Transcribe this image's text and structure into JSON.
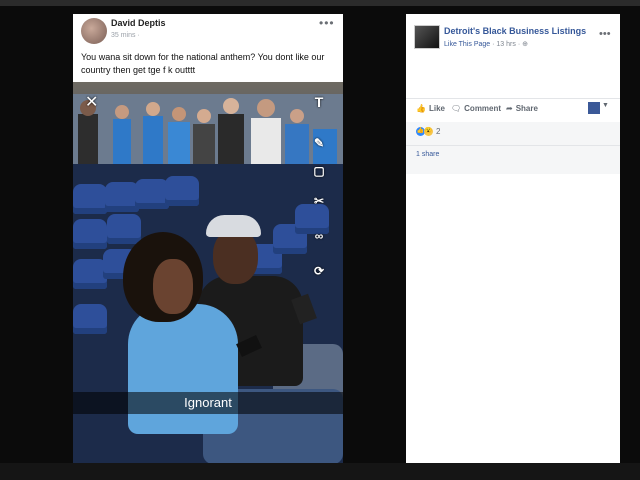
{
  "post": {
    "author": "David Deptis",
    "time": "35 mins ·",
    "text": "You wana sit down for the national anthem? You dont like our country then get tge f    k outttt"
  },
  "snap": {
    "caption": "Ignorant",
    "close_symbol": "✕",
    "text_tool_symbol": "T"
  },
  "card": {
    "page_name": "Detroit's Black Business Listings",
    "like_link": "Like This Page",
    "meta": "· 13 hrs ·",
    "like_label": "Like",
    "comment_label": "Comment",
    "share_label": "Share",
    "reaction_count": "2",
    "share_count": "1 share"
  },
  "icons": {
    "like": "thumbs-up-icon",
    "comment": "comment-icon",
    "share": "share-arrow-icon"
  },
  "colors": {
    "link_blue": "#365899",
    "facebook_blue": "#3b5998"
  }
}
